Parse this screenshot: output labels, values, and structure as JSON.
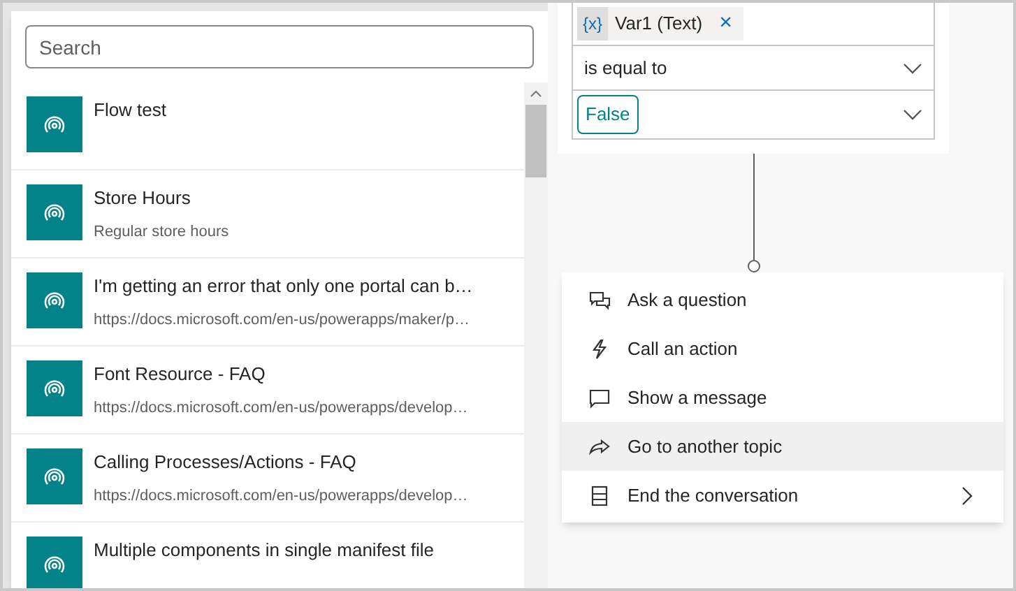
{
  "picker": {
    "search": {
      "placeholder": "Search"
    },
    "items": [
      {
        "title": "Flow test"
      },
      {
        "title": "Store Hours",
        "subtitle": "Regular store hours"
      },
      {
        "title": "I'm getting an error that only one portal can b…",
        "subtitle": "https://docs.microsoft.com/en-us/powerapps/maker/p…"
      },
      {
        "title": "Font Resource - FAQ",
        "subtitle": "https://docs.microsoft.com/en-us/powerapps/develop…"
      },
      {
        "title": "Calling Processes/Actions - FAQ",
        "subtitle": "https://docs.microsoft.com/en-us/powerapps/develop…"
      },
      {
        "title": "Multiple components in single manifest file"
      }
    ]
  },
  "condition": {
    "variable": {
      "icon_text": "{x}",
      "label": "Var1 (Text)",
      "remove": "×"
    },
    "operator": "is equal to",
    "value": "False"
  },
  "add_menu": [
    {
      "kind": "question",
      "label": "Ask a question",
      "selected": false
    },
    {
      "kind": "action",
      "label": "Call an action",
      "selected": false
    },
    {
      "kind": "message",
      "label": "Show a message",
      "selected": false
    },
    {
      "kind": "redirect",
      "label": "Go to another topic",
      "selected": true
    },
    {
      "kind": "end",
      "label": "End the conversation",
      "selected": false,
      "submenu": true
    }
  ]
}
